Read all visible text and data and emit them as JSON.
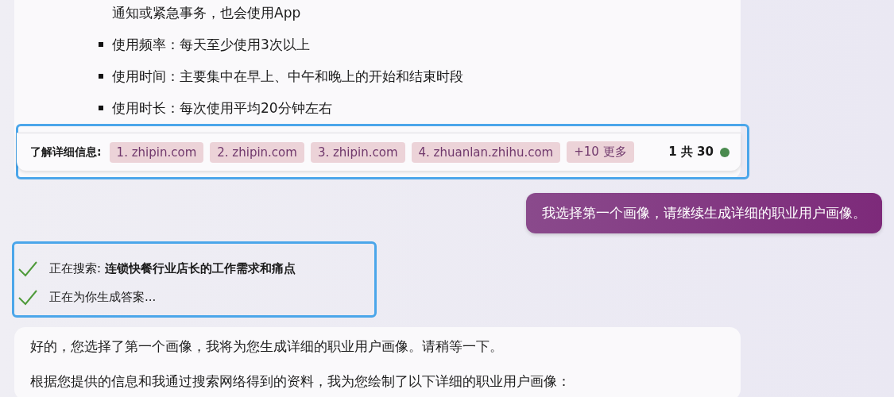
{
  "answer_top": {
    "continued_text": "通知或紧急事务，也会使用App",
    "bullets": [
      "使用频率：每天至少使用3次以上",
      "使用时间：主要集中在早上、中午和晚上的开始和结束时段",
      "使用时长：每次使用平均20分钟左右"
    ],
    "learn_more": {
      "label": "了解详细信息:",
      "sources": [
        "1. zhipin.com",
        "2. zhipin.com",
        "3. zhipin.com",
        "4. zhuanlan.zhihu.com"
      ],
      "more": "+10 更多",
      "count": "1 共 30"
    }
  },
  "user_message": "我选择第一个画像，请继续生成详细的职业用户画像。",
  "progress": [
    {
      "prefix": "正在搜索: ",
      "query": "连锁快餐行业店长的工作需求和痛点",
      "done": true
    },
    {
      "prefix": "正在为你生成答案...",
      "done": true
    }
  ],
  "answer": [
    "好的，您选择了第一个画像，我将为您生成详细的职业用户画像。请稍等一下。",
    "根据您提供的信息和我通过搜索网络得到的资料，我为您绘制了以下详细的职业用户画像："
  ]
}
